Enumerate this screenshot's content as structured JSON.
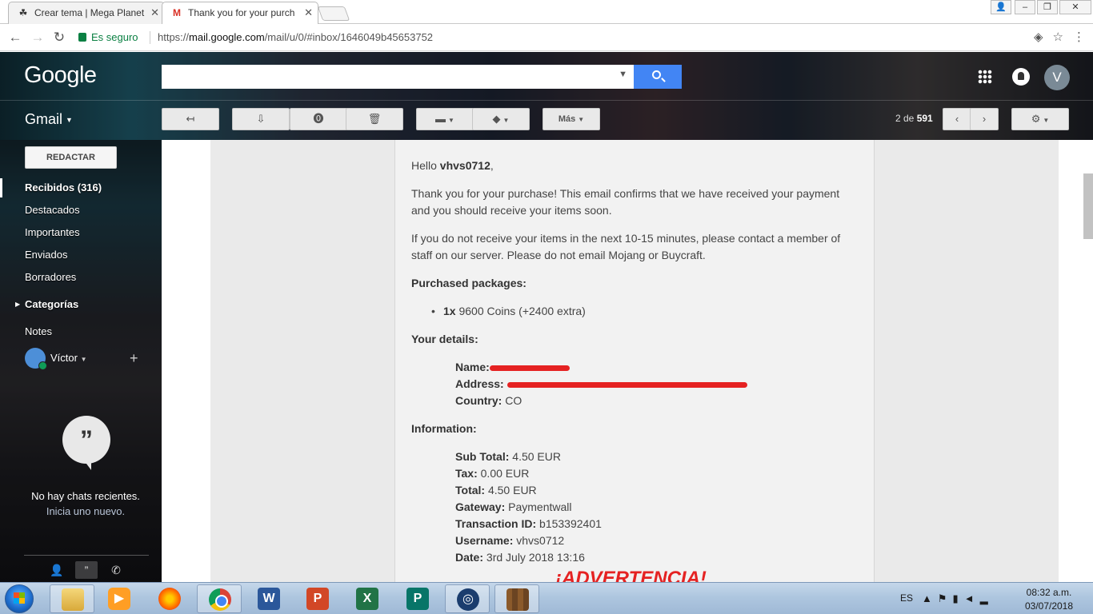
{
  "browser": {
    "tabs": [
      {
        "title": "Crear tema | Mega Planet"
      },
      {
        "title": "Thank you for your purch"
      }
    ],
    "secure_label": "Es seguro",
    "url_prefix": "https://",
    "url_host": "mail.google.com",
    "url_path": "/mail/u/0/#inbox/1646049b45653752"
  },
  "gmail": {
    "logo": "Google",
    "app_label": "Gmail",
    "avatar_initial": "V",
    "more_label": "Más",
    "pager": {
      "range": "2 de",
      "total": "591"
    },
    "compose": "REDACTAR",
    "folders": {
      "inbox": "Recibidos (316)",
      "starred": "Destacados",
      "important": "Importantes",
      "sent": "Enviados",
      "drafts": "Borradores",
      "categories": "Categorías",
      "notes": "Notes"
    },
    "hangouts": {
      "user": "Víctor",
      "no_chats": "No hay chats recientes.",
      "start_new": "Inicia uno nuevo."
    }
  },
  "email": {
    "greeting": "Hello",
    "username_bold": "vhvs0712",
    "para1": "Thank you for your purchase! This email confirms that we have received your payment and you should receive your items soon.",
    "para2": "If you do not receive your items in the next 10-15 minutes, please contact a member of staff on our server. Please do not email Mojang or Buycraft.",
    "packages_heading": "Purchased packages:",
    "package_qty": "1x",
    "package_name": "9600 Coins (+2400 extra)",
    "details_heading": "Your details:",
    "name_label": "Name:",
    "address_label": "Address:",
    "country_label": "Country:",
    "country_value": "CO",
    "info_heading": "Information:",
    "subtotal_label": "Sub Total:",
    "subtotal_value": "4.50 EUR",
    "tax_label": "Tax:",
    "tax_value": "0.00 EUR",
    "total_label": "Total:",
    "total_value": "4.50 EUR",
    "gateway_label": "Gateway:",
    "gateway_value": "Paymentwall",
    "txn_label": "Transaction ID:",
    "txn_value": "b153392401",
    "username_label": "Username:",
    "username_value": "vhvs0712",
    "date_label": "Date:",
    "date_value": "3rd July 2018 13:16",
    "warning": "¡ADVERTENCIA!"
  },
  "taskbar": {
    "language": "ES",
    "time": "08:32 a.m.",
    "date": "03/07/2018"
  },
  "colors": {
    "search_blue": "#4285f4",
    "redaction_red": "#e52222",
    "secure_green": "#0b8043"
  }
}
